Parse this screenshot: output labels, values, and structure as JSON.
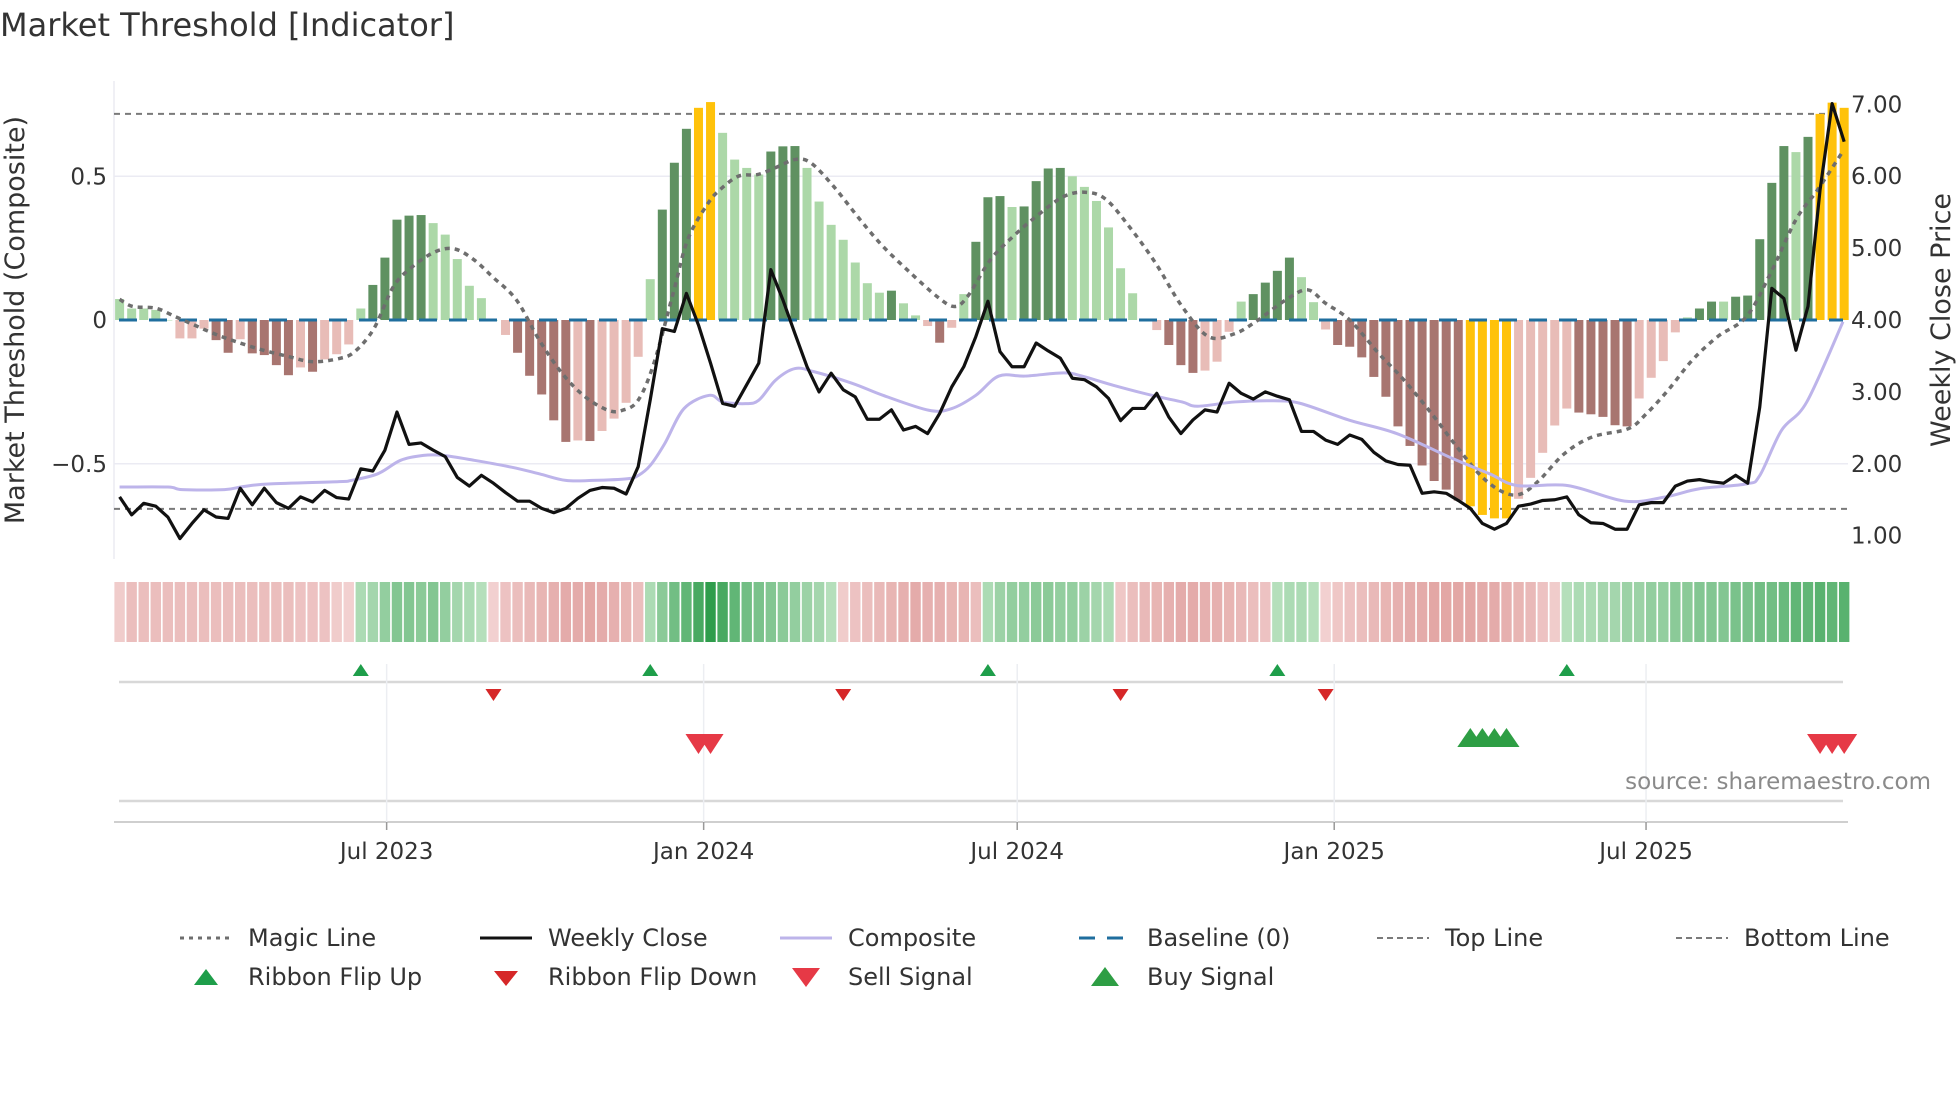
{
  "title": "Market Threshold [Indicator]",
  "source": "source: sharemaestro.com",
  "colors": {
    "G": "#5f9161",
    "g": "#acd8a8",
    "R": "#a87570",
    "r": "#e8bcb7",
    "Y": "#ffc20a",
    "magic": "#6e6e6e",
    "close": "#111111",
    "composite": "#bdb4ea",
    "baseline": "#1f6e9e",
    "threshold": "#7a7a7a",
    "flip_up": "#1e9e4a",
    "flip_down": "#d62728",
    "sell": "#e63946",
    "buy": "#2e9e44"
  },
  "chart_data": {
    "type": "bar",
    "title": "Market Threshold [Indicator]",
    "ylabel": "Market Threshold (Composite)",
    "y2label": "Weekly Close Price",
    "start_date": "2023-01-27",
    "interval": "weekly",
    "ylim": [
      -0.83,
      0.83
    ],
    "y2lim": [
      0.8,
      7.2
    ],
    "yticks": [
      {
        "v": 0.5,
        "label": "0.5"
      },
      {
        "v": 0,
        "label": "0"
      },
      {
        "v": -0.5,
        "label": "−0.5"
      }
    ],
    "y2ticks": [
      {
        "v": 7,
        "label": "7.00"
      },
      {
        "v": 6,
        "label": "6.00"
      },
      {
        "v": 5,
        "label": "5.00"
      },
      {
        "v": 4,
        "label": "4.00"
      },
      {
        "v": 3,
        "label": "3.00"
      },
      {
        "v": 2,
        "label": "2.00"
      },
      {
        "v": 1,
        "label": "1.00"
      }
    ],
    "xticks": [
      {
        "label": "Jul 2023",
        "date": "2023-07-01"
      },
      {
        "label": "Jan 2024",
        "date": "2024-01-01"
      },
      {
        "label": "Jul 2024",
        "date": "2024-07-01"
      },
      {
        "label": "Jan 2025",
        "date": "2025-01-01"
      },
      {
        "label": "Jul 2025",
        "date": "2025-07-01"
      }
    ],
    "top_line": 0.717,
    "bottom_line": -0.657,
    "baseline": 0,
    "threshold_bars": [
      0.073,
      0.04,
      0.04,
      0.035,
      0.0,
      -0.064,
      -0.064,
      -0.03,
      -0.07,
      -0.114,
      -0.067,
      -0.116,
      -0.122,
      -0.157,
      -0.192,
      -0.165,
      -0.18,
      -0.137,
      -0.119,
      -0.085,
      0.04,
      0.122,
      0.217,
      0.349,
      0.363,
      0.365,
      0.337,
      0.297,
      0.212,
      0.119,
      0.076,
      0.0,
      -0.052,
      -0.114,
      -0.194,
      -0.259,
      -0.349,
      -0.424,
      -0.419,
      -0.421,
      -0.386,
      -0.343,
      -0.288,
      -0.128,
      0.142,
      0.384,
      0.547,
      0.665,
      0.738,
      0.758,
      0.651,
      0.558,
      0.529,
      0.506,
      0.586,
      0.604,
      0.605,
      0.529,
      0.412,
      0.331,
      0.279,
      0.2,
      0.128,
      0.095,
      0.102,
      0.058,
      0.016,
      -0.021,
      -0.079,
      -0.027,
      0.09,
      0.272,
      0.427,
      0.431,
      0.393,
      0.395,
      0.483,
      0.527,
      0.529,
      0.5,
      0.463,
      0.414,
      0.322,
      0.18,
      0.093,
      0.0,
      -0.035,
      -0.087,
      -0.157,
      -0.184,
      -0.176,
      -0.145,
      -0.041,
      0.064,
      0.09,
      0.13,
      0.171,
      0.217,
      0.149,
      0.062,
      -0.033,
      -0.087,
      -0.093,
      -0.13,
      -0.198,
      -0.267,
      -0.37,
      -0.438,
      -0.506,
      -0.56,
      -0.59,
      -0.628,
      -0.648,
      -0.678,
      -0.69,
      -0.69,
      -0.622,
      -0.549,
      -0.462,
      -0.367,
      -0.308,
      -0.322,
      -0.328,
      -0.337,
      -0.366,
      -0.37,
      -0.273,
      -0.201,
      -0.143,
      -0.043,
      0.009,
      0.04,
      0.064,
      0.064,
      0.081,
      0.085,
      0.281,
      0.477,
      0.605,
      0.584,
      0.637,
      0.717,
      0.756,
      0.738
    ],
    "bar_classes": "gggggrrrRRrRRRRrRrrrgGGGGGggggggrRRRRRrRrrrrgGGGYYggggGGGgggggggGggrRrgGGGgGGGGgggggggrRRRrrrgGGGGggrRRRRRRRRRRRYYYYrrrrrRRRRRrrrrgGGgGGGGGgGYYY",
    "weekly_close": [
      1.54,
      1.29,
      1.45,
      1.41,
      1.26,
      0.96,
      1.17,
      1.36,
      1.26,
      1.24,
      1.66,
      1.43,
      1.66,
      1.46,
      1.38,
      1.54,
      1.47,
      1.63,
      1.53,
      1.51,
      1.93,
      1.9,
      2.19,
      2.72,
      2.27,
      2.29,
      2.19,
      2.1,
      1.81,
      1.69,
      1.84,
      1.73,
      1.6,
      1.48,
      1.48,
      1.38,
      1.32,
      1.38,
      1.52,
      1.63,
      1.67,
      1.66,
      1.58,
      1.96,
      2.89,
      3.88,
      3.84,
      4.37,
      3.93,
      3.4,
      2.84,
      2.8,
      3.1,
      3.4,
      4.7,
      4.28,
      3.81,
      3.35,
      3.0,
      3.26,
      3.03,
      2.93,
      2.62,
      2.62,
      2.75,
      2.47,
      2.52,
      2.42,
      2.7,
      3.07,
      3.35,
      3.77,
      4.26,
      3.56,
      3.35,
      3.35,
      3.68,
      3.57,
      3.47,
      3.19,
      3.17,
      3.07,
      2.91,
      2.6,
      2.77,
      2.77,
      2.98,
      2.65,
      2.42,
      2.61,
      2.75,
      2.72,
      3.12,
      2.98,
      2.9,
      3.0,
      2.94,
      2.89,
      2.45,
      2.45,
      2.33,
      2.27,
      2.4,
      2.34,
      2.16,
      2.04,
      1.99,
      1.98,
      1.59,
      1.61,
      1.59,
      1.49,
      1.38,
      1.17,
      1.09,
      1.17,
      1.41,
      1.44,
      1.49,
      1.5,
      1.54,
      1.29,
      1.18,
      1.17,
      1.09,
      1.09,
      1.43,
      1.46,
      1.46,
      1.69,
      1.76,
      1.78,
      1.75,
      1.73,
      1.84,
      1.73,
      2.79,
      4.44,
      4.3,
      3.58,
      4.19,
      5.81,
      7.01,
      6.48
    ],
    "magic_line": [
      [
        0,
        0.072
      ],
      [
        1.1,
        0.047
      ],
      [
        3,
        0.041
      ],
      [
        4.6,
        0.012
      ],
      [
        5.9,
        -0.012
      ],
      [
        7.8,
        -0.047
      ],
      [
        9.7,
        -0.076
      ],
      [
        11.9,
        -0.105
      ],
      [
        14.1,
        -0.128
      ],
      [
        16,
        -0.145
      ],
      [
        18.2,
        -0.134
      ],
      [
        19.5,
        -0.11
      ],
      [
        21.1,
        -0.029
      ],
      [
        22.7,
        0.116
      ],
      [
        24.3,
        0.186
      ],
      [
        26.2,
        0.238
      ],
      [
        27.8,
        0.247
      ],
      [
        29.4,
        0.209
      ],
      [
        30.9,
        0.151
      ],
      [
        32.9,
        0.07
      ],
      [
        34.8,
        -0.07
      ],
      [
        36.7,
        -0.186
      ],
      [
        38.6,
        -0.267
      ],
      [
        40.5,
        -0.314
      ],
      [
        41.7,
        -0.314
      ],
      [
        43,
        -0.279
      ],
      [
        44.3,
        -0.151
      ],
      [
        45.9,
        0.093
      ],
      [
        47.1,
        0.279
      ],
      [
        48.7,
        0.4
      ],
      [
        49.7,
        0.45
      ],
      [
        51.3,
        0.5
      ],
      [
        52.9,
        0.506
      ],
      [
        54.4,
        0.53
      ],
      [
        56,
        0.558
      ],
      [
        57.3,
        0.547
      ],
      [
        59.2,
        0.465
      ],
      [
        61.4,
        0.349
      ],
      [
        63.3,
        0.256
      ],
      [
        65.6,
        0.163
      ],
      [
        67.8,
        0.081
      ],
      [
        69.2,
        0.047
      ],
      [
        70.3,
        0.081
      ],
      [
        72.2,
        0.209
      ],
      [
        74.1,
        0.291
      ],
      [
        76,
        0.36
      ],
      [
        78.3,
        0.43
      ],
      [
        80.2,
        0.444
      ],
      [
        81.8,
        0.419
      ],
      [
        83.7,
        0.326
      ],
      [
        85.9,
        0.198
      ],
      [
        88.1,
        0.047
      ],
      [
        90.3,
        -0.058
      ],
      [
        92.5,
        -0.047
      ],
      [
        94.4,
        0
      ],
      [
        96.7,
        0.07
      ],
      [
        98.5,
        0.105
      ],
      [
        100,
        0.058
      ],
      [
        102,
        0
      ],
      [
        104.4,
        -0.116
      ],
      [
        106.5,
        -0.209
      ],
      [
        108.8,
        -0.326
      ],
      [
        110.9,
        -0.442
      ],
      [
        113,
        -0.547
      ],
      [
        114.8,
        -0.6
      ],
      [
        116.2,
        -0.605
      ],
      [
        117.7,
        -0.558
      ],
      [
        119.8,
        -0.465
      ],
      [
        122.1,
        -0.407
      ],
      [
        125.1,
        -0.378
      ],
      [
        126.6,
        -0.326
      ],
      [
        128.4,
        -0.244
      ],
      [
        130.4,
        -0.14
      ],
      [
        132.5,
        -0.058
      ],
      [
        134.9,
        0.012
      ],
      [
        136.9,
        0.163
      ],
      [
        139,
        0.349
      ],
      [
        140.8,
        0.453
      ],
      [
        142.9,
        0.587
      ]
    ],
    "composite": [
      [
        0,
        -0.581
      ],
      [
        4,
        -0.581
      ],
      [
        5.2,
        -0.59
      ],
      [
        8.7,
        -0.59
      ],
      [
        10.3,
        -0.579
      ],
      [
        12.5,
        -0.57
      ],
      [
        18.2,
        -0.562
      ],
      [
        19.2,
        -0.558
      ],
      [
        21.4,
        -0.535
      ],
      [
        23.3,
        -0.488
      ],
      [
        25.2,
        -0.471
      ],
      [
        26.8,
        -0.471
      ],
      [
        29.4,
        -0.488
      ],
      [
        32.5,
        -0.512
      ],
      [
        34.8,
        -0.535
      ],
      [
        37,
        -0.558
      ],
      [
        39.2,
        -0.558
      ],
      [
        42.1,
        -0.552
      ],
      [
        43,
        -0.541
      ],
      [
        44,
        -0.506
      ],
      [
        45.2,
        -0.43
      ],
      [
        46.8,
        -0.308
      ],
      [
        48.9,
        -0.262
      ],
      [
        50,
        -0.285
      ],
      [
        51.9,
        -0.291
      ],
      [
        53,
        -0.279
      ],
      [
        54.4,
        -0.209
      ],
      [
        56,
        -0.169
      ],
      [
        57.6,
        -0.18
      ],
      [
        60.8,
        -0.221
      ],
      [
        63.3,
        -0.262
      ],
      [
        67.1,
        -0.314
      ],
      [
        69,
        -0.308
      ],
      [
        71,
        -0.262
      ],
      [
        72.9,
        -0.195
      ],
      [
        75.1,
        -0.195
      ],
      [
        78.3,
        -0.184
      ],
      [
        79.8,
        -0.195
      ],
      [
        82.4,
        -0.227
      ],
      [
        85.6,
        -0.262
      ],
      [
        88.1,
        -0.285
      ],
      [
        89.4,
        -0.3
      ],
      [
        92.5,
        -0.285
      ],
      [
        95.7,
        -0.281
      ],
      [
        97.9,
        -0.29
      ],
      [
        102,
        -0.349
      ],
      [
        105.9,
        -0.395
      ],
      [
        110.6,
        -0.483
      ],
      [
        113.6,
        -0.535
      ],
      [
        115.9,
        -0.576
      ],
      [
        120.1,
        -0.576
      ],
      [
        124.8,
        -0.63
      ],
      [
        128.1,
        -0.616
      ],
      [
        131,
        -0.587
      ],
      [
        134.9,
        -0.57
      ],
      [
        136,
        -0.541
      ],
      [
        137.8,
        -0.384
      ],
      [
        139.9,
        -0.285
      ],
      [
        142.9,
        -0.006
      ]
    ],
    "ribbon": [
      -0.2,
      -0.35,
      -0.35,
      -0.35,
      -0.35,
      -0.35,
      -0.35,
      -0.35,
      -0.35,
      -0.35,
      -0.35,
      -0.35,
      -0.35,
      -0.35,
      -0.35,
      -0.3,
      -0.3,
      -0.3,
      -0.2,
      -0.15,
      0.25,
      0.3,
      0.4,
      0.5,
      0.5,
      0.45,
      0.5,
      0.4,
      0.3,
      0.25,
      0.2,
      -0.15,
      -0.3,
      -0.35,
      -0.4,
      -0.45,
      -0.5,
      -0.55,
      -0.55,
      -0.6,
      -0.55,
      -0.5,
      -0.45,
      -0.35,
      0.25,
      0.45,
      0.6,
      0.7,
      0.85,
      1.0,
      0.85,
      0.7,
      0.6,
      0.55,
      0.5,
      0.45,
      0.4,
      0.35,
      0.3,
      0.2,
      -0.2,
      -0.3,
      -0.35,
      -0.4,
      -0.45,
      -0.5,
      -0.55,
      -0.5,
      -0.5,
      -0.45,
      -0.45,
      -0.35,
      0.25,
      0.35,
      0.4,
      0.4,
      0.45,
      0.45,
      0.4,
      0.4,
      0.35,
      0.3,
      0.25,
      -0.25,
      -0.35,
      -0.4,
      -0.45,
      -0.5,
      -0.55,
      -0.55,
      -0.5,
      -0.5,
      -0.45,
      -0.4,
      -0.35,
      -0.3,
      0.2,
      0.25,
      0.25,
      0.2,
      -0.15,
      -0.25,
      -0.3,
      -0.35,
      -0.4,
      -0.45,
      -0.5,
      -0.55,
      -0.55,
      -0.6,
      -0.6,
      -0.6,
      -0.6,
      -0.55,
      -0.55,
      -0.5,
      -0.45,
      -0.4,
      -0.3,
      -0.2,
      0.2,
      0.25,
      0.25,
      0.3,
      0.3,
      0.35,
      0.35,
      0.4,
      0.4,
      0.45,
      0.45,
      0.5,
      0.5,
      0.5,
      0.55,
      0.55,
      0.6,
      0.6,
      0.65,
      0.7,
      0.7,
      0.75,
      0.7,
      0.75
    ],
    "ribbon_flip_up": [
      20,
      44,
      72,
      96,
      120
    ],
    "ribbon_flip_down": [
      31,
      60,
      83,
      100
    ],
    "sell_signals": [
      48,
      49,
      141,
      142,
      143
    ],
    "buy_signals": [
      112,
      113,
      114,
      115
    ],
    "legend_position": "bottom"
  },
  "legend": [
    {
      "label": "Magic Line",
      "icon": "dotted-line"
    },
    {
      "label": "Weekly Close",
      "icon": "solid-line"
    },
    {
      "label": "Composite",
      "icon": "solid-line"
    },
    {
      "label": "Baseline (0)",
      "icon": "dashed-line"
    },
    {
      "label": "Top Line",
      "icon": "dashed-line"
    },
    {
      "label": "Bottom Line",
      "icon": "dashed-line"
    },
    {
      "label": "Ribbon Flip Up",
      "icon": "triangle-up"
    },
    {
      "label": "Ribbon Flip Down",
      "icon": "triangle-down"
    },
    {
      "label": "Sell Signal",
      "icon": "triangle-down"
    },
    {
      "label": "Buy Signal",
      "icon": "triangle-up"
    }
  ]
}
